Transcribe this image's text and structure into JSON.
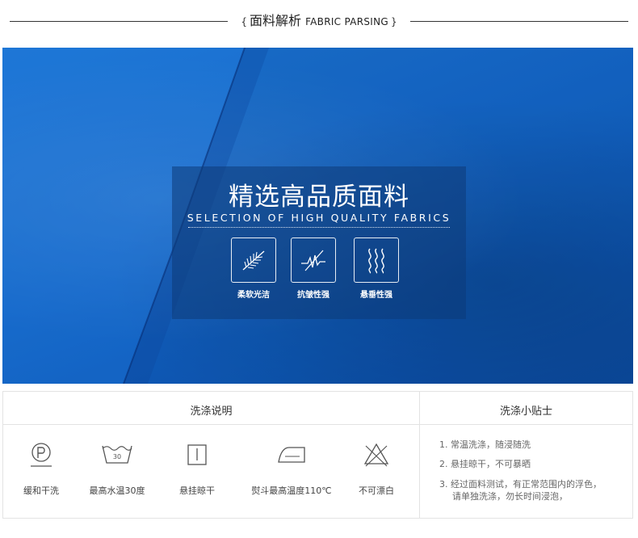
{
  "header": {
    "brace_open": "{",
    "title_cn": "面料解析",
    "title_en": "FABRIC PARSING",
    "brace_close": "}"
  },
  "banner": {
    "headline": "精选高品质面料",
    "subheadline": "SELECTION OF HIGH QUALITY FABRICS",
    "colors": {
      "fabric_blue": "#1467c8",
      "panel": "#0d3a78"
    },
    "features": [
      {
        "icon": "feather-icon",
        "label": "柔软光洁"
      },
      {
        "icon": "wrinkle-resist-icon",
        "label": "抗皱性强"
      },
      {
        "icon": "drape-wave-icon",
        "label": "悬垂性强"
      }
    ]
  },
  "care": {
    "wash_title": "洗涤说明",
    "tips_title": "洗涤小贴士",
    "symbols": [
      {
        "icon": "dry-clean-p-icon",
        "label": "缓和干洗"
      },
      {
        "icon": "wash-30-icon",
        "label": "最高水温30度",
        "temp": "30"
      },
      {
        "icon": "hang-dry-icon",
        "label": "悬挂晾干"
      },
      {
        "icon": "iron-icon",
        "label": "熨斗最高温度110℃"
      },
      {
        "icon": "no-bleach-icon",
        "label": "不可漂白"
      }
    ],
    "tips": [
      "1. 常温洗涤，随浸随洗",
      "2. 悬挂晾干，不可暴晒",
      "3. 经过面料测试，有正常范围内的浮色，",
      "请单独洗涤，勿长时间浸泡，"
    ]
  }
}
